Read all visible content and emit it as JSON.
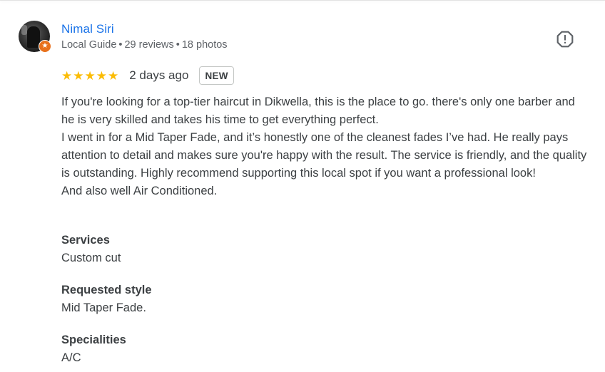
{
  "reviewer": {
    "name": "Nimal Siri",
    "badge": "Local Guide",
    "reviews": "29 reviews",
    "photos": "18 photos",
    "separator": "•",
    "avatar_icon": "profile-photo",
    "badge_icon": "local-guide-star-icon"
  },
  "review": {
    "rating": 5,
    "max_rating": 5,
    "date": "2 days ago",
    "new_label": "NEW",
    "paragraphs": [
      "If you're looking for a top-tier haircut in Dikwella, this is the place to go. there's only one barber and he is very skilled and takes his time to get everything perfect.",
      "I went in for a Mid Taper Fade, and it’s honestly one of the cleanest fades I’ve had. He really pays attention to detail and makes sure you're happy with the result. The service is friendly, and the quality is outstanding. Highly recommend supporting this local spot if you want a professional look!",
      "And also well Air Conditioned."
    ],
    "attributes": [
      {
        "label": "Services",
        "value": "Custom cut"
      },
      {
        "label": "Requested style",
        "value": "Mid Taper Fade."
      },
      {
        "label": "Specialities",
        "value": "A/C"
      }
    ]
  },
  "colors": {
    "name_link": "#1a73e8",
    "star": "#fbbc04",
    "badge_orange": "#e8711c",
    "text": "#3c4043",
    "secondary_text": "#5f6368"
  },
  "icons": {
    "report": "report-flag-icon",
    "star": "star-icon"
  }
}
